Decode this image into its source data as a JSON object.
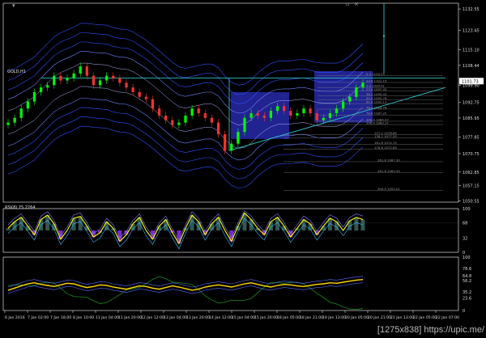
{
  "window": {
    "title": "GOLD,H1",
    "buttons": [
      "▾",
      "▫",
      "×"
    ]
  },
  "colors": {
    "background": "#000000",
    "frame": "#ffffff",
    "bull_candle": "#00ff00",
    "bear_candle": "#ff3030",
    "envelope_blue": "#3050ff",
    "envelope_inner": "#7080ff",
    "trend_line": "#30c0c0",
    "box_fill": "#2b2fc0",
    "stoch_line": "#ffff00",
    "stoch_hist_pos": "#3a5f5a",
    "stoch_hist_neg": "#8a2be2",
    "osc_line": "#ffd700",
    "osc_green": "#1a7a1a",
    "osc_blue": "#5a6cff"
  },
  "watermark": "[1275x838] https://upic.me/",
  "chart_data": [
    {
      "type": "line",
      "title": "GOLD,H1",
      "ylim": [
        1050,
        1135
      ],
      "y_ticks": [
        "1132.55",
        "1123.45",
        "1115.10",
        "1108.44",
        "1099.90",
        "1092.75",
        "1085.95",
        "1077.85",
        "1070.75",
        "1062.85",
        "1057.15",
        "1050.55"
      ],
      "current_price": "1101.73",
      "x_ticks": [
        "6 Jan 2016",
        "7 Jan 02:00",
        "7 Jan 18:00",
        "8 Jan 10:00",
        "11 Jan 04:00",
        "11 Jan 20:00",
        "12 Jan 12:00",
        "13 Jan 04:00",
        "13 Jan 20:00",
        "14 Jan 12:00",
        "15 Jan 04:00",
        "15 Jan 20:00",
        "18 Jan 05:00",
        "18 Jan 21:00",
        "19 Jan 13:00",
        "20 Jan 05:00",
        "20 Jan 21:00",
        "21 Jan 13:00",
        "22 Jan 05:00",
        "22 Jan 07:00"
      ],
      "close_series": [
        1084,
        1086,
        1090,
        1093,
        1097,
        1099,
        1100,
        1104,
        1102,
        1103,
        1105,
        1108,
        1104,
        1100,
        1102,
        1104,
        1103,
        1101,
        1099,
        1097,
        1095,
        1094,
        1090,
        1087,
        1085,
        1083,
        1084,
        1087,
        1090,
        1088,
        1086,
        1084,
        1079,
        1072,
        1075,
        1080,
        1086,
        1088,
        1087,
        1086,
        1089,
        1091,
        1089,
        1087,
        1088,
        1090,
        1088,
        1085,
        1086,
        1088,
        1090,
        1093,
        1095,
        1099,
        1101
      ],
      "fib_levels": [
        {
          "label": "0.0 1104.15",
          "y": 1104.15
        },
        {
          "label": "23.6 1101.15",
          "y": 1101.15
        },
        {
          "label": "0.0 1099.01",
          "y": 1099.01
        },
        {
          "label": "23.6 1097.45",
          "y": 1097.45
        },
        {
          "label": "38.2 1095.43",
          "y": 1095.43
        },
        {
          "label": "50.0 1093.78",
          "y": 1093.78
        },
        {
          "label": "61.8 1092.12",
          "y": 1092.12
        },
        {
          "label": "76.4 1089.76",
          "y": 1089.76
        },
        {
          "label": "78.6 1087.25",
          "y": 1087.25
        },
        {
          "label": "100.0 1084.57",
          "y": 1084.57
        },
        {
          "label": "100.0 1083.17",
          "y": 1083.17
        },
        {
          "label": "127.2 1078.85",
          "y": 1078.85
        },
        {
          "label": "138.2 1077.55",
          "y": 1077.55
        },
        {
          "label": "161.8 1074.75",
          "y": 1074.75
        },
        {
          "label": "178.6 1072.65",
          "y": 1072.65
        },
        {
          "label": "261.8 1067.30",
          "y": 1067.3
        },
        {
          "label": "261.8 1062.55",
          "y": 1062.55
        },
        {
          "label": "300.0 1055.01",
          "y": 1055.01
        }
      ]
    },
    {
      "type": "line",
      "title": "RSI(8) 75.2264",
      "ylim": [
        0,
        100
      ],
      "y_ticks": [
        "100",
        "68",
        "32",
        "0"
      ],
      "stoch_series": [
        55,
        70,
        80,
        60,
        40,
        75,
        85,
        65,
        30,
        50,
        78,
        82,
        60,
        35,
        45,
        70,
        55,
        25,
        40,
        65,
        80,
        50,
        30,
        60,
        75,
        45,
        20,
        55,
        85,
        70,
        40,
        65,
        80,
        50,
        25,
        60,
        90,
        75,
        55,
        40,
        70,
        80,
        60,
        35,
        55,
        75,
        65,
        40,
        60,
        78,
        70,
        50,
        72,
        80,
        75
      ]
    },
    {
      "type": "line",
      "title": "",
      "ylim": [
        0,
        100
      ],
      "y_ticks": [
        "100",
        "78.6",
        "64.8",
        "56.2",
        "35.2",
        "23.6",
        "0"
      ],
      "osc_series": [
        38,
        42,
        46,
        50,
        52,
        49,
        47,
        45,
        48,
        51,
        50,
        46,
        43,
        45,
        48,
        47,
        44,
        42,
        40,
        43,
        46,
        45,
        42,
        40,
        43,
        46,
        44,
        41,
        38,
        40,
        44,
        46,
        48,
        46,
        44,
        47,
        50,
        52,
        49,
        46,
        44,
        47,
        49,
        48,
        46,
        45,
        47,
        49,
        50,
        52,
        51,
        53,
        55,
        57,
        58
      ]
    }
  ]
}
